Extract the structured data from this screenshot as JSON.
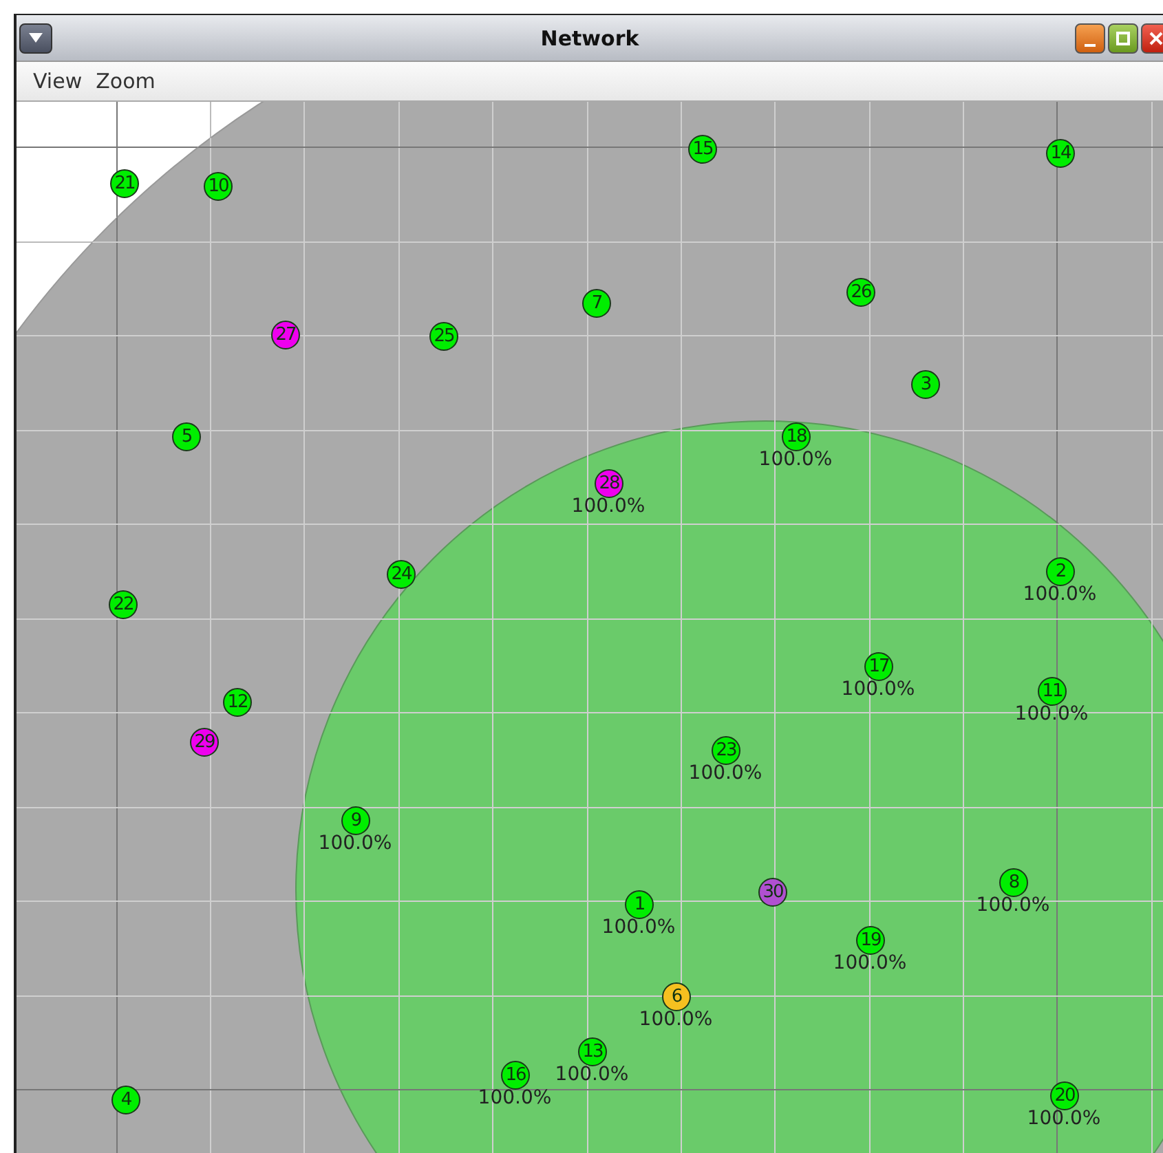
{
  "window": {
    "title": "Network"
  },
  "menu": [
    "View",
    "Zoom"
  ],
  "nodes": [
    {
      "label": "21",
      "color": "#00ee00"
    },
    {
      "label": "10",
      "color": "#00ee00"
    },
    {
      "label": "15",
      "color": "#00ee00"
    },
    {
      "label": "14",
      "color": "#00ee00"
    },
    {
      "label": "7",
      "color": "#00ee00"
    },
    {
      "label": "26",
      "color": "#00ee00"
    },
    {
      "label": "27",
      "color": "#ee00ee"
    },
    {
      "label": "25",
      "color": "#00ee00"
    },
    {
      "label": "3",
      "color": "#00ee00"
    },
    {
      "label": "5",
      "color": "#00ee00"
    },
    {
      "label": "18",
      "color": "#00ee00",
      "reading": "100.0%"
    },
    {
      "label": "28",
      "color": "#ee00ee",
      "reading": "100.0%"
    },
    {
      "label": "24",
      "color": "#00ee00"
    },
    {
      "label": "2",
      "color": "#00ee00",
      "reading": "100.0%"
    },
    {
      "label": "22",
      "color": "#00ee00"
    },
    {
      "label": "17",
      "color": "#00ee00",
      "reading": "100.0%"
    },
    {
      "label": "12",
      "color": "#00ee00"
    },
    {
      "label": "11",
      "color": "#00ee00",
      "reading": "100.0%"
    },
    {
      "label": "29",
      "color": "#ee00ee"
    },
    {
      "label": "23",
      "color": "#00ee00",
      "reading": "100.0%"
    },
    {
      "label": "9",
      "color": "#00ee00",
      "reading": "100.0%"
    },
    {
      "label": "8",
      "color": "#00ee00",
      "reading": "100.0%"
    },
    {
      "label": "1",
      "color": "#00ee00",
      "reading": "100.0%"
    },
    {
      "label": "30",
      "color": "#b050d0"
    },
    {
      "label": "19",
      "color": "#00ee00",
      "reading": "100.0%"
    },
    {
      "label": "6",
      "color": "#f5c020",
      "reading": "100.0%"
    },
    {
      "label": "13",
      "color": "#00ee00",
      "reading": "100.0%"
    },
    {
      "label": "4",
      "color": "#00ee00"
    },
    {
      "label": "16",
      "color": "#00ee00",
      "reading": "100.0%"
    },
    {
      "label": "20",
      "color": "#00ee00",
      "reading": "100.0%"
    }
  ]
}
